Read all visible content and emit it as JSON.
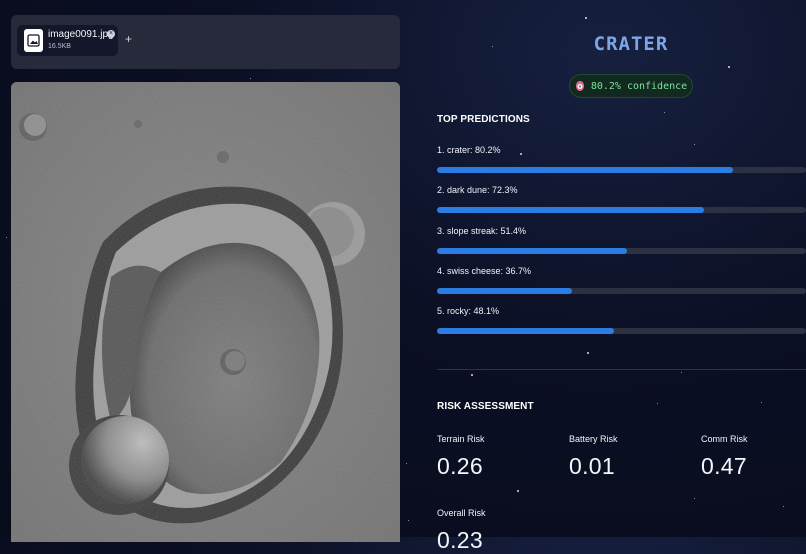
{
  "uploader": {
    "file_name": "image0091.jpg",
    "file_size": "16.5KB",
    "remove_icon": "close-circle-icon",
    "add_label": "+"
  },
  "image": {
    "alt": "crater-image"
  },
  "prediction": {
    "class_name": "CRATER",
    "confidence_text": "80.2% confidence",
    "confidence_icon": "target-icon"
  },
  "top_predictions": {
    "title": "TOP PREDICTIONS",
    "items": [
      {
        "label": "1. crater: 80.2%",
        "value": 0.802
      },
      {
        "label": "2. dark dune: 72.3%",
        "value": 0.723
      },
      {
        "label": "3. slope streak: 51.4%",
        "value": 0.514
      },
      {
        "label": "4. swiss cheese: 36.7%",
        "value": 0.367
      },
      {
        "label": "5. rocky: 48.1%",
        "value": 0.481
      }
    ]
  },
  "risk": {
    "title": "RISK ASSESSMENT",
    "terrain": {
      "label": "Terrain Risk",
      "value": "0.26"
    },
    "battery": {
      "label": "Battery Risk",
      "value": "0.01"
    },
    "comm": {
      "label": "Comm Risk",
      "value": "0.47"
    },
    "overall": {
      "label": "Overall Risk",
      "value": "0.23"
    }
  },
  "colors": {
    "accent": "#2b7de3",
    "title": "#7ea6e6",
    "confidence_green": "#7ee39b",
    "background": "#0b0f24"
  }
}
